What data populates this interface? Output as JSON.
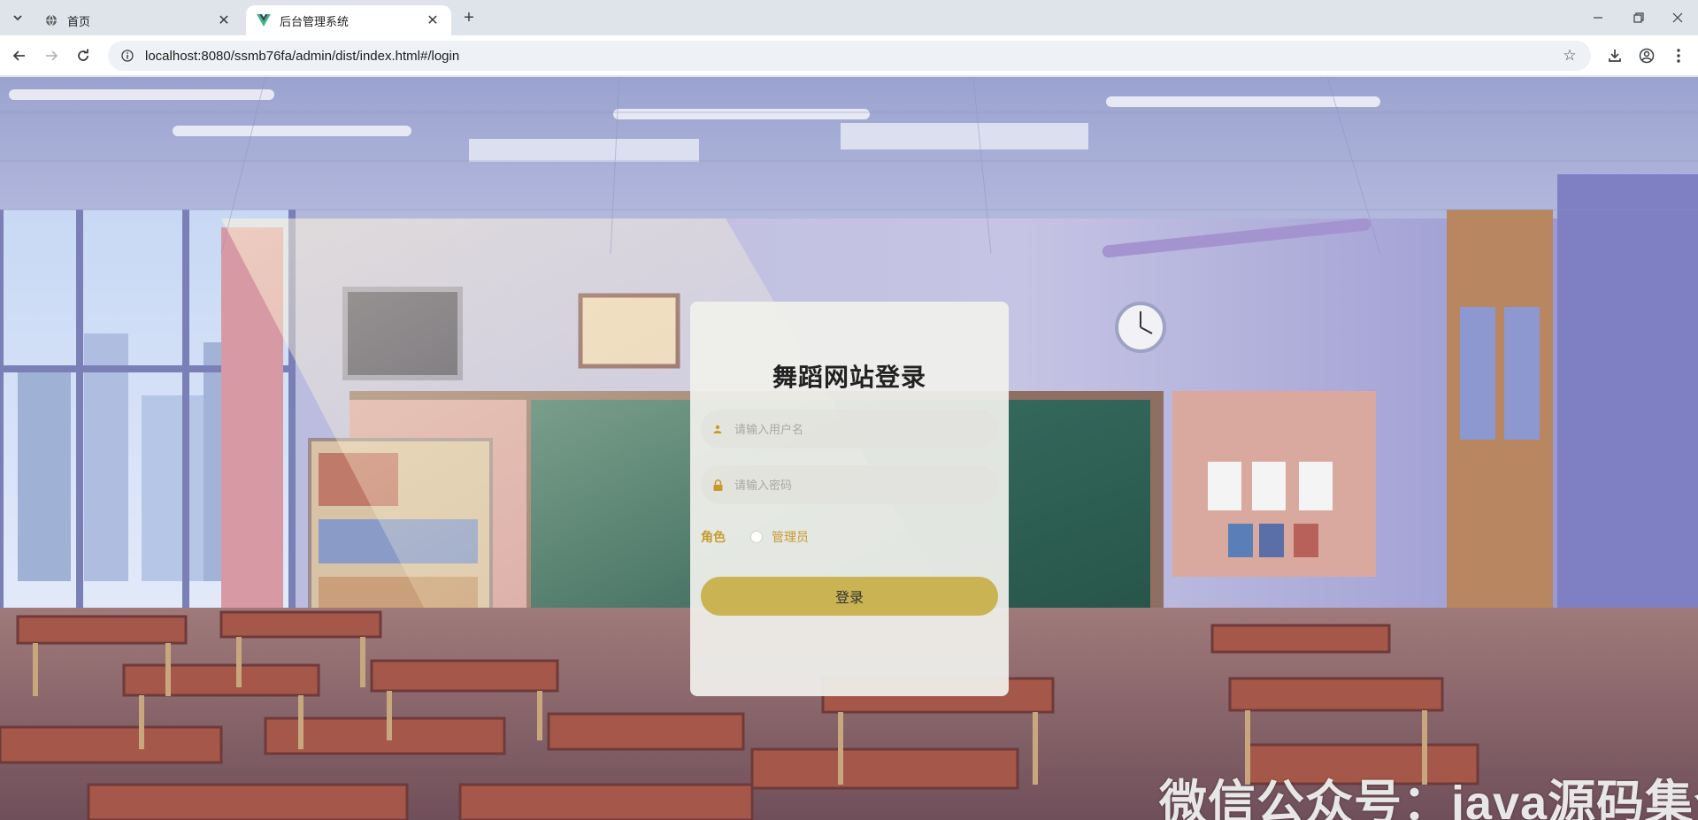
{
  "browser": {
    "tabs": [
      {
        "title": "首页",
        "icon": "globe-icon",
        "active": false
      },
      {
        "title": "后台管理系统",
        "icon": "vue-logo-icon",
        "active": true
      }
    ],
    "url": "localhost:8080/ssmb76fa/admin/dist/index.html#/login"
  },
  "login": {
    "title": "舞蹈网站登录",
    "username_placeholder": "请输入用户名",
    "password_placeholder": "请输入密码",
    "role_label": "角色",
    "role_options": [
      "管理员"
    ],
    "submit_label": "登录",
    "accent_color": "#c9b353",
    "label_color": "#c89a2e"
  },
  "watermark": "微信公众号：java源码集合"
}
